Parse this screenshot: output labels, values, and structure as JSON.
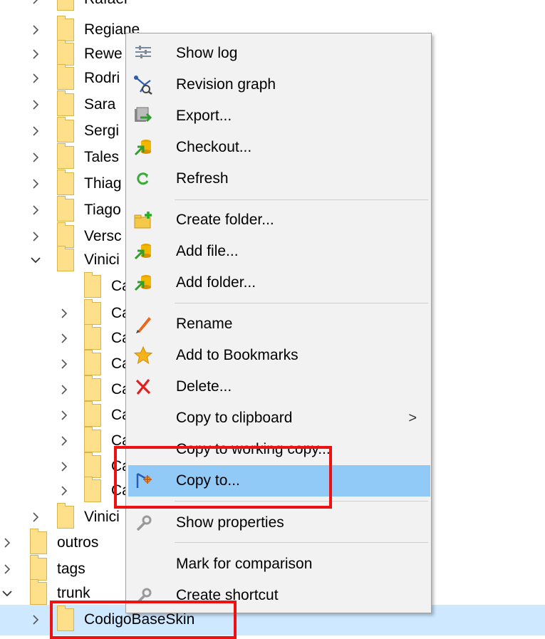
{
  "tree": {
    "rows": [
      {
        "label": "Rafael",
        "expanded": false
      },
      {
        "label": "Regiane",
        "expanded": false
      },
      {
        "label": "Rewe",
        "expanded": false
      },
      {
        "label": "Rodri",
        "expanded": false
      },
      {
        "label": "Sara",
        "expanded": false
      },
      {
        "label": "Sergi",
        "expanded": false
      },
      {
        "label": "Tales",
        "expanded": false
      },
      {
        "label": "Thiag",
        "expanded": false
      },
      {
        "label": "Tiago",
        "expanded": false
      },
      {
        "label": "Versc",
        "expanded": false
      },
      {
        "label": "Vinici",
        "expanded": true
      },
      {
        "label": "Ca",
        "expanded": false
      },
      {
        "label": "Ca",
        "expanded": false
      },
      {
        "label": "Ca",
        "expanded": false
      },
      {
        "label": "Ca",
        "expanded": false
      },
      {
        "label": "Ca",
        "expanded": false
      },
      {
        "label": "Ca",
        "expanded": false
      },
      {
        "label": "Ca",
        "expanded": false
      },
      {
        "label": "Ca",
        "expanded": false
      },
      {
        "label": "Ca",
        "expanded": false
      },
      {
        "label": "Vinici",
        "expanded": false
      },
      {
        "label": "outros",
        "expanded": false
      },
      {
        "label": "tags",
        "expanded": false
      },
      {
        "label": "trunk",
        "expanded": true
      },
      {
        "label": "CodigoBaseSkin",
        "expanded": false,
        "selected": true
      }
    ]
  },
  "menu": {
    "items": [
      {
        "label": "Show log",
        "icon": "show-log-icon"
      },
      {
        "label": "Revision graph",
        "icon": "revision-graph-icon"
      },
      {
        "label": "Export...",
        "icon": "export-icon"
      },
      {
        "label": "Checkout...",
        "icon": "checkout-icon"
      },
      {
        "label": "Refresh",
        "icon": "refresh-icon"
      },
      {
        "label": "Create folder...",
        "icon": "create-folder-icon"
      },
      {
        "label": "Add file...",
        "icon": "add-file-icon"
      },
      {
        "label": "Add folder...",
        "icon": "add-folder-icon"
      },
      {
        "label": "Rename",
        "icon": "rename-icon"
      },
      {
        "label": "Add to Bookmarks",
        "icon": "bookmark-star-icon"
      },
      {
        "label": "Delete...",
        "icon": "delete-icon"
      },
      {
        "label": "Copy to clipboard",
        "icon": "",
        "submenu": true
      },
      {
        "label": "Copy to working copy...",
        "icon": ""
      },
      {
        "label": "Copy to...",
        "icon": "copy-to-icon",
        "highlighted": true
      },
      {
        "label": "Show properties",
        "icon": "properties-wrench-icon"
      },
      {
        "label": "Mark for comparison",
        "icon": ""
      },
      {
        "label": "Create shortcut",
        "icon": "create-shortcut-icon"
      }
    ],
    "submenu_arrow": ">"
  },
  "colors": {
    "selection": "#cde8ff",
    "highlight": "#91c9f7",
    "annotation": "#ee1111"
  }
}
